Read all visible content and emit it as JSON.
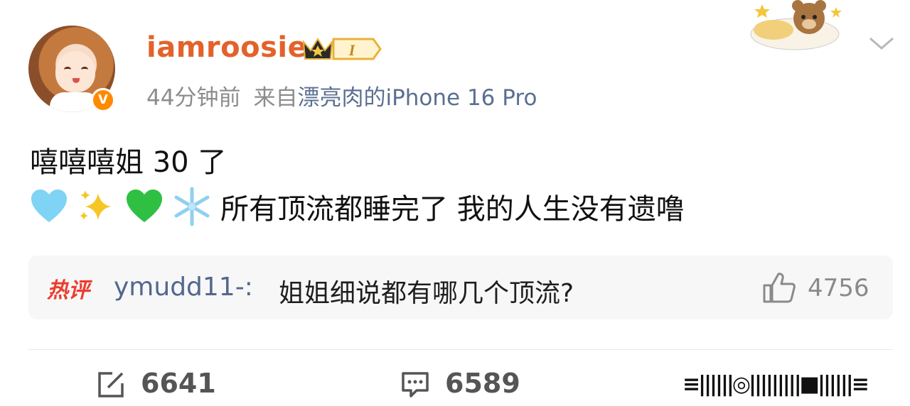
{
  "post": {
    "username": "iamroosie",
    "level_badge": "I",
    "time": "44分钟前",
    "source_prefix": "来自",
    "device": "漂亮肉的iPhone 16 Pro",
    "line1": "嘻嘻嘻姐 30 了",
    "line2_emojis": [
      "light-blue-heart",
      "sparkles",
      "green-heart",
      "snowflake"
    ],
    "line2_text": "所有顶流都睡完了 我的人生没有遗噜"
  },
  "hot_comment": {
    "tag": "热评",
    "user": "ymudd11-:",
    "text": "姐姐细说都有哪几个顶流?",
    "likes": "4756"
  },
  "actions": {
    "reposts": "6641",
    "comments": "6589",
    "watermark": "≡||||||◎|||||||||■||||||≡"
  },
  "colors": {
    "username": "#e3622b",
    "device_link": "#5b6f91",
    "hot_tag": "#ea3d2f",
    "comment_user": "#53668e",
    "verified_badge": "#ff8a00"
  }
}
